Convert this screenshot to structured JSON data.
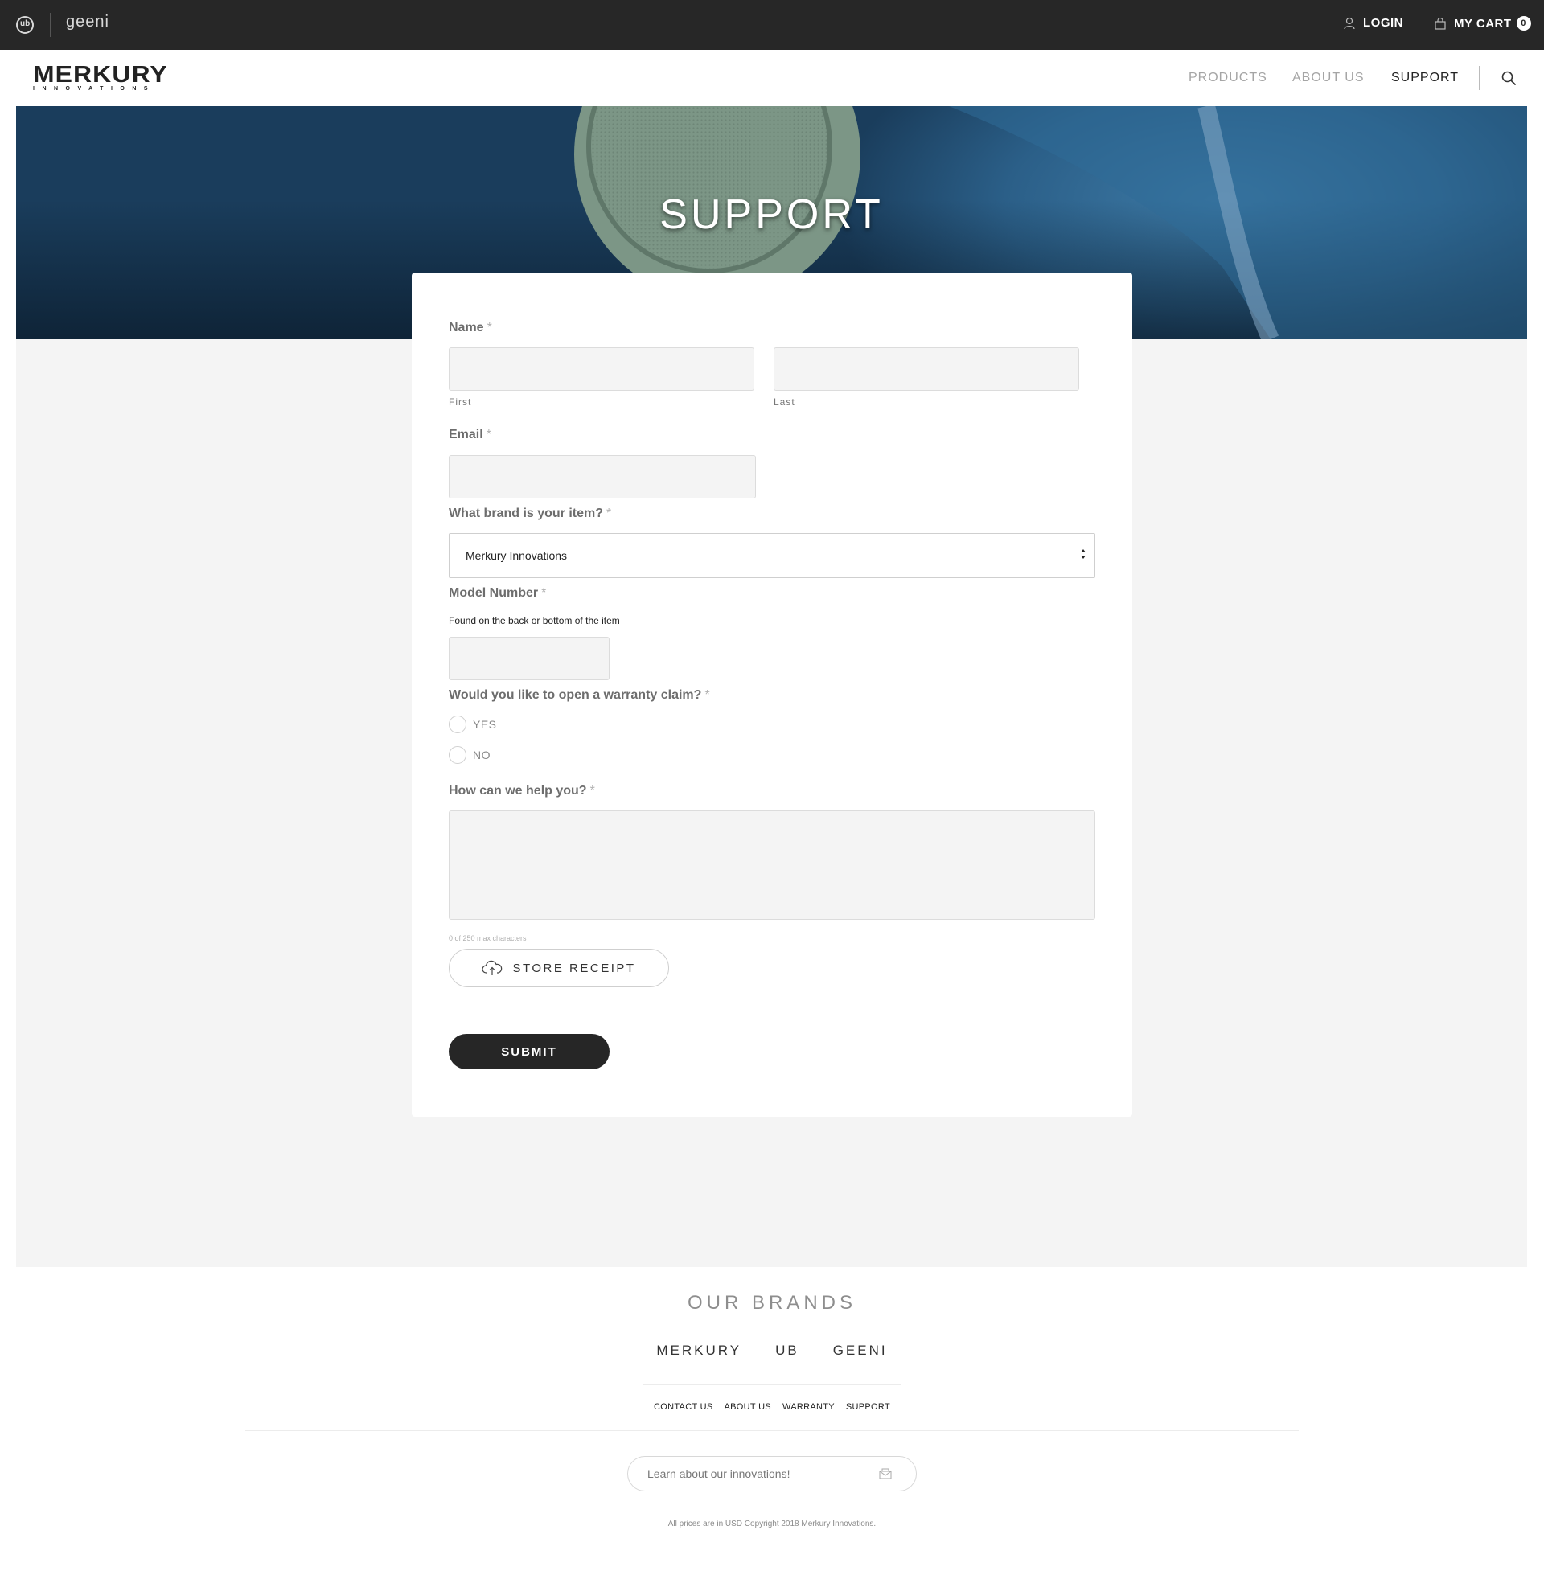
{
  "topbar": {
    "brand_ub": "ub",
    "brand_geeni": "geeni",
    "login_label": "LOGIN",
    "cart_label": "MY CART",
    "cart_count": "0"
  },
  "header": {
    "logo_word": "MERKURY",
    "logo_sub": "INNOVATIONS",
    "nav": [
      "PRODUCTS",
      "ABOUT US",
      "SUPPORT"
    ],
    "active_nav": "SUPPORT"
  },
  "hero": {
    "title": "SUPPORT"
  },
  "form": {
    "name_label": "Name",
    "required_mark": "*",
    "first_sublabel": "First",
    "last_sublabel": "Last",
    "first_value": "",
    "last_value": "",
    "email_label": "Email",
    "email_value": "",
    "brand_label": "What brand is your item?",
    "brand_selected": "Merkury Innovations",
    "model_label": "Model Number",
    "model_hint": "Found on the back or bottom of the item",
    "model_value": "",
    "warranty_label": "Would you like to open a warranty claim?",
    "warranty_options": [
      "YES",
      "NO"
    ],
    "help_label": "How can we help you?",
    "help_value": "",
    "char_counter": "0 of 250 max characters",
    "upload_label": "STORE RECEIPT",
    "submit_label": "SUBMIT"
  },
  "footer": {
    "brands_title": "OUR BRANDS",
    "brands": [
      "MERKURY",
      "UB",
      "GEENI"
    ],
    "links": [
      "CONTACT US",
      "ABOUT US",
      "WARRANTY",
      "SUPPORT"
    ],
    "newsletter_placeholder": "Learn about our innovations!",
    "copyright": "All prices are in USD Copyright 2018 Merkury Innovations."
  },
  "colors": {
    "topbar_bg": "#272727",
    "body_bg": "#f4f4f4",
    "submit_bg": "#262626",
    "nav_inactive": "#a5a5a5"
  }
}
